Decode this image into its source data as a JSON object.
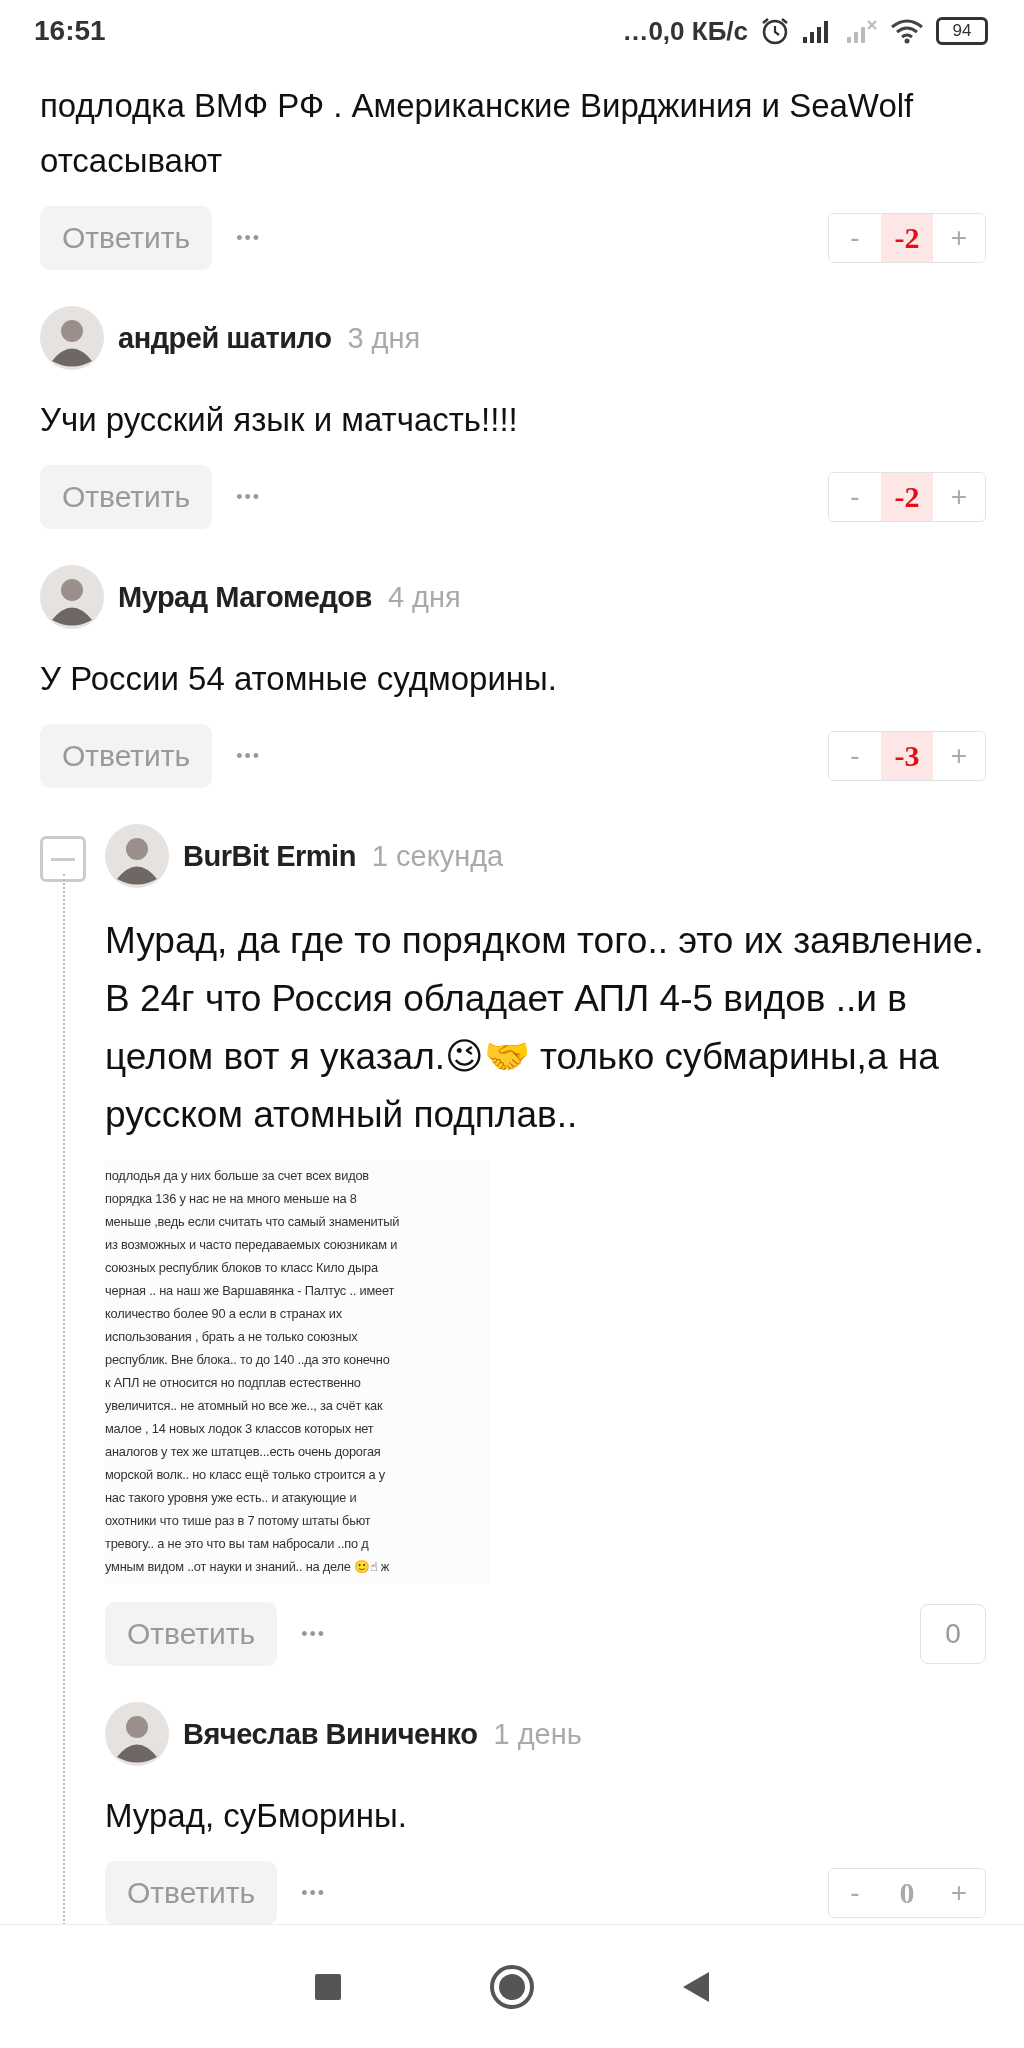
{
  "status_bar": {
    "time": "16:51",
    "network_speed": "…0,0 КБ/с",
    "battery": "94"
  },
  "comments": [
    {
      "text": "подлодка ВМФ РФ . Американские Вирджиния и SeaWolf отсасывают",
      "reply_label": "Ответить",
      "more": "•••",
      "vote": {
        "kind": "rating",
        "minus": "-",
        "score": "-2",
        "plus": "+",
        "negative": true
      }
    },
    {
      "author": "андрей шатило",
      "time": "3 дня",
      "text": "Учи русский язык и матчасть!!!!",
      "reply_label": "Ответить",
      "more": "•••",
      "vote": {
        "kind": "rating",
        "minus": "-",
        "score": "-2",
        "plus": "+",
        "negative": true
      }
    },
    {
      "author": "Мурад Магомедов",
      "time": "4 дня",
      "text": "У России 54 атомные судморины.",
      "reply_label": "Ответить",
      "more": "•••",
      "vote": {
        "kind": "rating",
        "minus": "-",
        "score": "-3",
        "plus": "+",
        "negative": true
      },
      "replies_expanded": true,
      "replies": [
        {
          "author": "BurBit Ermin",
          "time": "1 секунда",
          "text": "Мурад, да где то порядком того.. это их заявление. В 24г что Россия обладает АПЛ 4-5 видов ..и в целом вот я указал.😉🤝 только субмарины,а на русском атомный подплав..",
          "attachment": {
            "lines": [
              "подлодья да у них больше за счет всех видов",
              "порядка 136 у нас не на много меньше на 8",
              "меньше ,ведь если считать что самый знаменитый",
              "из возможных и часто передаваемых союзникам и",
              "союзных республик блоков то класс Кило дыра",
              "черная .. на наш же Варшавянка - Палтус .. имеет",
              "количество более 90 а если в странах их",
              "использования , брать а не только союзных",
              "республик. Вне блока.. то до 140 ..да это конечно",
              "к АПЛ не относится но подплав естественно",
              "увеличится.. не атомный но все же.., за счёт как",
              "малое , 14 новых лодок 3 классов которых нет",
              "аналогов у тех же штатцев...есть очень дорогая",
              "морской волк.. но класс ещё только строится а у",
              "нас такого уровня уже есть.. и атакующие и",
              "охотники что тише раз в 7 потому штаты бьют",
              "тревогу.. а не это что вы там набросали ..по д",
              "умным видом ..от науки и знаний.. на деле 🙂☝ ж"
            ]
          },
          "reply_label": "Ответить",
          "more": "•••",
          "vote": {
            "kind": "count",
            "score": "0",
            "negative": false
          }
        },
        {
          "author": "Вячеслав Виниченко",
          "time": "1 день",
          "text": "Мурад, суБморины.",
          "reply_label": "Ответить",
          "more": "•••",
          "vote": {
            "kind": "rating",
            "minus": "-",
            "score": "0",
            "plus": "+",
            "negative": false
          }
        }
      ]
    }
  ]
}
